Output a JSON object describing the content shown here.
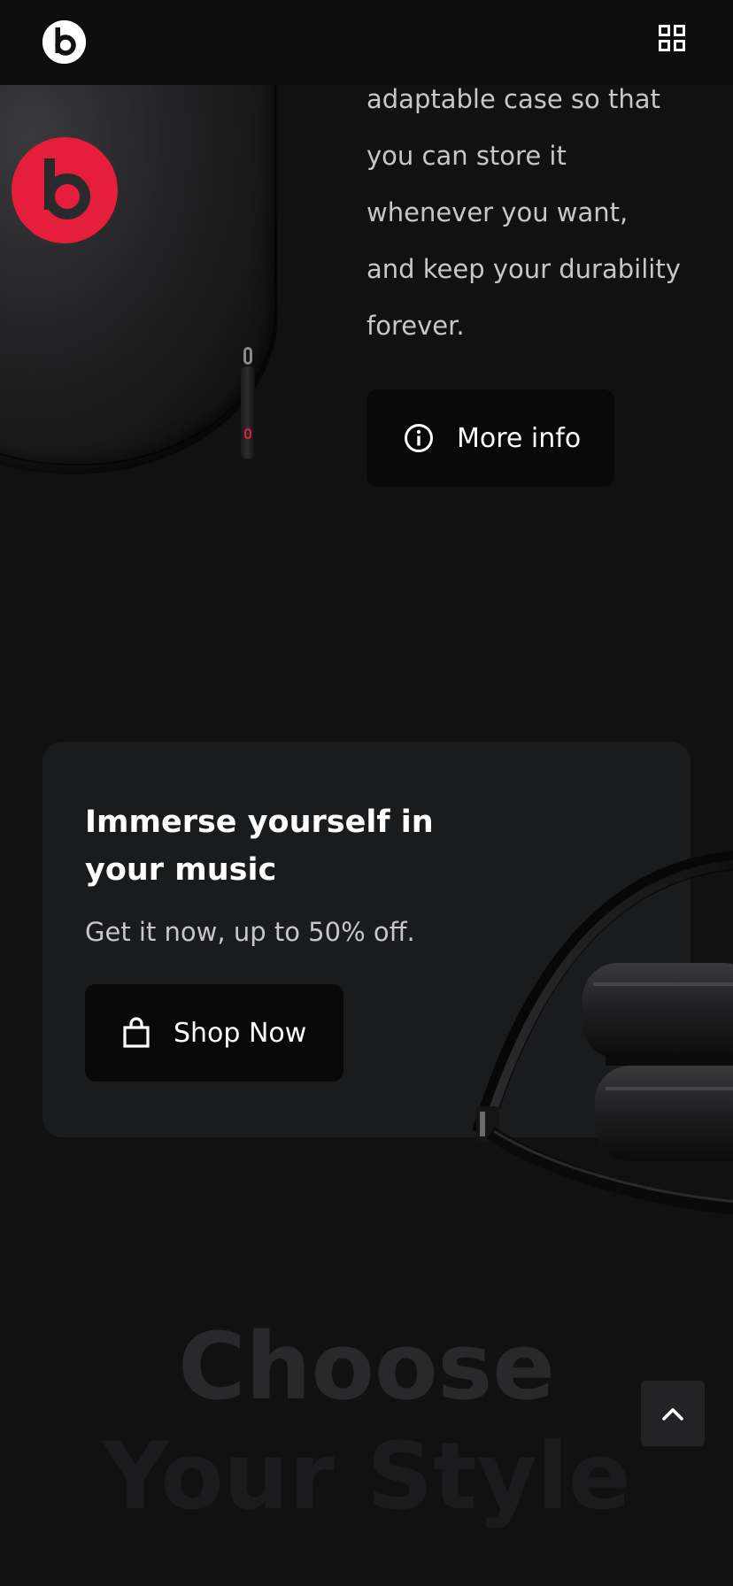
{
  "header": {
    "logo_icon": "beats-logo-icon",
    "menu_icon": "grid-menu-icon"
  },
  "feature": {
    "description_lines": [
      "adaptable case so that",
      "you can store it",
      "whenever you want,",
      "and keep your durability",
      "forever."
    ],
    "more_info_label": "More info",
    "more_info_icon": "info-circle-icon"
  },
  "promo": {
    "title_lines": [
      "Immerse yourself in",
      "your music"
    ],
    "subtitle": "Get it now, up to 50% off.",
    "shop_label": "Shop Now",
    "shop_icon": "shopping-bag-icon"
  },
  "section": {
    "heading_line1": "Choose",
    "heading_line2": "Your Style"
  },
  "scroll_top_icon": "chevron-up-icon",
  "colors": {
    "background": "#111112",
    "card": "#1a1b1d",
    "button": "#080808",
    "brand_red": "#e51e3c"
  }
}
